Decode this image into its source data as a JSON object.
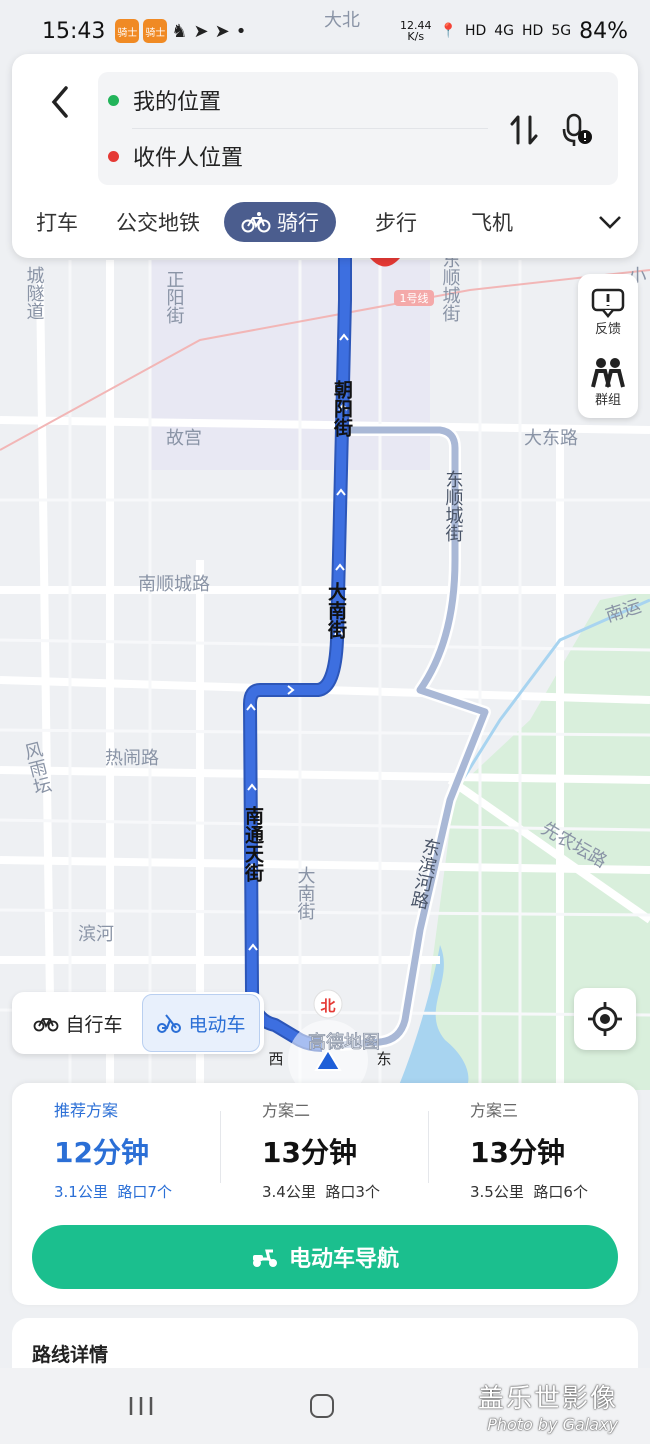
{
  "status_bar": {
    "time": "15:43",
    "badge_text": "骑士",
    "net_speed_value": "12.44",
    "net_speed_unit": "K/s",
    "hd1": "HD",
    "sig1": "4G",
    "hd2": "HD",
    "sig2": "5G",
    "battery": "84%"
  },
  "top_card": {
    "origin": "我的位置",
    "destination": "收件人位置",
    "colors": {
      "origin_dot": "#22b45a",
      "destination_dot": "#e53935"
    }
  },
  "modes": {
    "items": [
      "打车",
      "公交地铁",
      "骑行",
      "步行",
      "飞机"
    ],
    "selected": "骑行"
  },
  "side": {
    "feedback": "反馈",
    "group": "群组"
  },
  "map": {
    "labels": {
      "da_bei": "大北",
      "gu_gong": "故宫",
      "da_dong_lu": "大东路",
      "nan_shun_cheng_lu": "南顺城路",
      "re_nao_lu": "热闹路",
      "bin_he": "滨河",
      "line1": "1号线",
      "nan_yun": "南运",
      "xian_nong_tan_lu": "先农坛路",
      "north": "北",
      "west": "西",
      "east": "东",
      "brand": "高德地图",
      "v_zheng_yang_jie": "正阳街",
      "v_dong_shun_cheng_jie": "东顺城街",
      "v_dong_shun_cheng_jie2": "东顺城街",
      "v_chao_yang_jie": "朝阳街",
      "v_da_nan_jie": "大南街",
      "v_nan_tong_tian_jie": "南通天街",
      "v_dong_bin_he_lu": "东滨河路",
      "v_da_nan_jie2": "大南街",
      "v_feng_yu_tan": "风雨坛",
      "v_cheng_sui_dao": "城隧道",
      "v_xiao": "小"
    },
    "colors": {
      "route": "#3d6fe0",
      "alt_route": "#a9b8d6",
      "green_area": "#d8efdc",
      "water": "#a8d4f0"
    }
  },
  "vehicle_toggle": {
    "bike": "自行车",
    "ebike": "电动车",
    "selected": "电动车"
  },
  "plans": [
    {
      "name": "推荐方案",
      "time": "12分钟",
      "distance": "3.1公里",
      "junctions": "路口7个"
    },
    {
      "name": "方案二",
      "time": "13分钟",
      "distance": "3.4公里",
      "junctions": "路口3个"
    },
    {
      "name": "方案三",
      "time": "13分钟",
      "distance": "3.5公里",
      "junctions": "路口6个"
    }
  ],
  "nav_button": "电动车导航",
  "details_title": "路线详情",
  "watermark": {
    "line1": "盖乐世影像",
    "line2": "Photo by Galaxy"
  },
  "icons": [
    "back-icon",
    "swap-icon",
    "voice-icon",
    "bike-icon",
    "chevron-down-icon",
    "feedback-icon",
    "group-icon",
    "locate-icon",
    "ebike-icon"
  ]
}
